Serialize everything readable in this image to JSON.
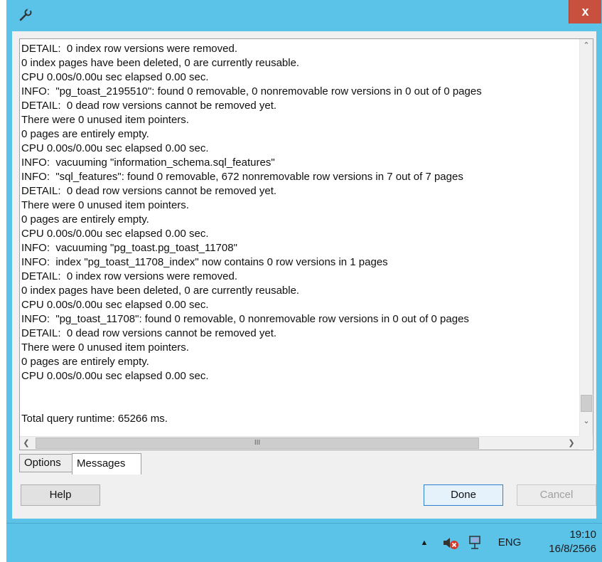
{
  "window": {
    "close_label": "x"
  },
  "log": {
    "lines": [
      "DETAIL:  0 index row versions were removed.",
      "0 index pages have been deleted, 0 are currently reusable.",
      "CPU 0.00s/0.00u sec elapsed 0.00 sec.",
      "INFO:  \"pg_toast_2195510\": found 0 removable, 0 nonremovable row versions in 0 out of 0 pages",
      "DETAIL:  0 dead row versions cannot be removed yet.",
      "There were 0 unused item pointers.",
      "0 pages are entirely empty.",
      "CPU 0.00s/0.00u sec elapsed 0.00 sec.",
      "INFO:  vacuuming \"information_schema.sql_features\"",
      "INFO:  \"sql_features\": found 0 removable, 672 nonremovable row versions in 7 out of 7 pages",
      "DETAIL:  0 dead row versions cannot be removed yet.",
      "There were 0 unused item pointers.",
      "0 pages are entirely empty.",
      "CPU 0.00s/0.00u sec elapsed 0.00 sec.",
      "INFO:  vacuuming \"pg_toast.pg_toast_11708\"",
      "INFO:  index \"pg_toast_11708_index\" now contains 0 row versions in 1 pages",
      "DETAIL:  0 index row versions were removed.",
      "0 index pages have been deleted, 0 are currently reusable.",
      "CPU 0.00s/0.00u sec elapsed 0.00 sec.",
      "INFO:  \"pg_toast_11708\": found 0 removable, 0 nonremovable row versions in 0 out of 0 pages",
      "DETAIL:  0 dead row versions cannot be removed yet.",
      "There were 0 unused item pointers.",
      "0 pages are entirely empty.",
      "CPU 0.00s/0.00u sec elapsed 0.00 sec.",
      "",
      "",
      "Total query runtime: 65266 ms."
    ]
  },
  "tabs": {
    "options": "Options",
    "messages": "Messages"
  },
  "buttons": {
    "help": "Help",
    "done": "Done",
    "cancel": "Cancel"
  },
  "taskbar": {
    "lang": "ENG",
    "time": "19:10",
    "date": "16/8/2566"
  },
  "colors": {
    "chrome": "#5bc2e8",
    "close": "#c7503e",
    "dialog": "#f0f0f0"
  }
}
